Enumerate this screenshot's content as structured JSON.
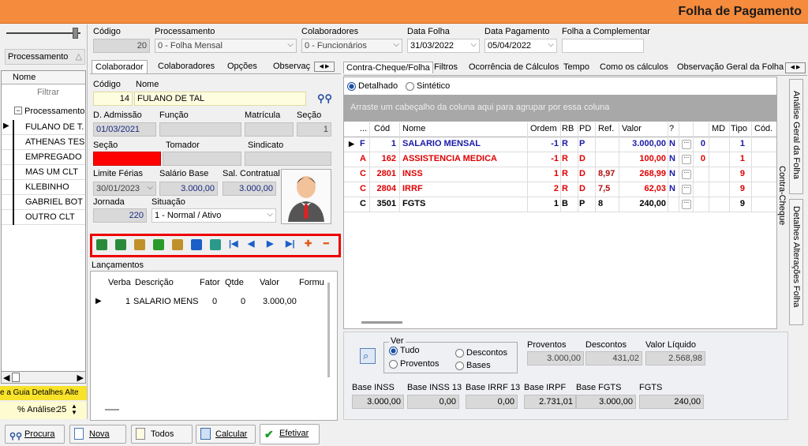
{
  "window": {
    "title": "Folha de Pagamento"
  },
  "left_panel": {
    "group_label": "Processamento",
    "header": "Nome",
    "filter_placeholder": "Filtrar",
    "tree_root": "Processamento",
    "employees": [
      "FULANO DE T.",
      "ATHENAS TES",
      "EMPREGADO",
      "MAS UM CLT",
      "KLEBINHO",
      "GABRIEL BOT",
      "OUTRO CLT"
    ],
    "banner": "e a Guia Detalhes Alte",
    "analysis_label": "% Análise:",
    "analysis_value": "25"
  },
  "header": {
    "codigo_label": "Código",
    "codigo_value": "20",
    "processamento_label": "Processamento",
    "processamento_value": "0 - Folha Mensal",
    "colaboradores_label": "Colaboradores",
    "colaboradores_value": "0 - Funcionários",
    "data_folha_label": "Data Folha",
    "data_folha_value": "31/03/2022",
    "data_pagamento_label": "Data Pagamento",
    "data_pagamento_value": "05/04/2022",
    "folha_complementar_label": "Folha a Complementar"
  },
  "left_tabs": [
    "Colaborador",
    "Colaboradores",
    "Opções",
    "Observaç"
  ],
  "employee": {
    "codigo_label": "Código",
    "nome_label": "Nome",
    "codigo": "14",
    "nome": "FULANO DE TAL",
    "admissao_label": "D. Admissão",
    "admissao": "01/03/2021",
    "funcao_label": "Função",
    "matricula_label": "Matrícula",
    "secao_label": "Seção",
    "secao_value": "1",
    "secao2_label": "Seção",
    "tomador_label": "Tomador",
    "sindicato_label": "Sindicato",
    "limite_ferias_label": "Limite Férias",
    "limite_ferias": "30/01/2023",
    "salario_base_label": "Salário Base",
    "salario_base": "3.000,00",
    "sal_contratual_label": "Sal. Contratual",
    "sal_contratual": "3.000,00",
    "jornada_label": "Jornada",
    "jornada": "220",
    "situacao_label": "Situação",
    "situacao": "1 - Normal / Ativo"
  },
  "lancamentos": {
    "title": "Lançamentos",
    "columns": [
      "Verba",
      "Descrição",
      "Fator",
      "Qtde",
      "Valor",
      "Formu"
    ],
    "rows": [
      [
        "1",
        "SALARIO MENS",
        "0",
        "0",
        "3.000,00",
        ""
      ]
    ]
  },
  "right_tabs": [
    "Contra-Cheque/Folha",
    "Filtros",
    "Ocorrência de Cálculos",
    "Tempo",
    "Como os cálculos",
    "Observação Geral da Folha"
  ],
  "view_mode": {
    "detalhado": "Detalhado",
    "sintetico": "Sintético"
  },
  "group_hint": "Arraste um cabeçalho da coluna aqui para agrupar por essa coluna",
  "grid": {
    "columns": [
      "...",
      "Cód",
      "Nome",
      "Ordem",
      "RB",
      "PD",
      "Ref.",
      "Valor",
      "?",
      "",
      "MD",
      "Tipo",
      "Cód."
    ],
    "rows": [
      {
        "flag": "F",
        "cod": "1",
        "nome": "SALARIO MENSAL",
        "ordem": "-1",
        "rb": "R",
        "pd": "P",
        "ref": "",
        "valor": "3.000,00",
        "q": "N",
        "md": "0",
        "tipo": "1",
        "color": "#1a1aa8"
      },
      {
        "flag": "A",
        "cod": "162",
        "nome": "ASSISTENCIA MEDICA",
        "ordem": "-1",
        "rb": "R",
        "pd": "D",
        "ref": "",
        "valor": "100,00",
        "q": "N",
        "md": "0",
        "tipo": "1",
        "color": "#e00000"
      },
      {
        "flag": "C",
        "cod": "2801",
        "nome": "INSS",
        "ordem": "1",
        "rb": "R",
        "pd": "D",
        "ref": "8,97",
        "valor": "268,99",
        "q": "N",
        "md": "",
        "tipo": "9",
        "color": "#e00000"
      },
      {
        "flag": "C",
        "cod": "2804",
        "nome": "IRRF",
        "ordem": "2",
        "rb": "R",
        "pd": "D",
        "ref": "7,5",
        "valor": "62,03",
        "q": "N",
        "md": "",
        "tipo": "9",
        "color": "#e00000"
      },
      {
        "flag": "C",
        "cod": "3501",
        "nome": "FGTS",
        "ordem": "1",
        "rb": "B",
        "pd": "P",
        "ref": "8",
        "valor": "240,00",
        "q": "",
        "md": "",
        "tipo": "9",
        "color": "#000000"
      }
    ]
  },
  "side_tabs": [
    "Análise Geral da Folha",
    "Detalhes Alterações Folha"
  ],
  "inner_side_tab": "Contra-Cheque",
  "summary": {
    "ver_label": "Ver",
    "options": [
      "Tudo",
      "Proventos",
      "Descontos",
      "Bases"
    ],
    "proventos_label": "Proventos",
    "proventos": "3.000,00",
    "descontos_label": "Descontos",
    "descontos": "431,02",
    "liquido_label": "Valor Líquido",
    "liquido": "2.568,98",
    "bases": [
      {
        "label": "Base INSS",
        "value": "3.000,00"
      },
      {
        "label": "Base INSS 13",
        "value": "0,00"
      },
      {
        "label": "Base IRRF 13",
        "value": "0,00"
      },
      {
        "label": "Base IRPF",
        "value": "2.731,01"
      },
      {
        "label": "Base FGTS",
        "value": "3.000,00"
      },
      {
        "label": "FGTS",
        "value": "240,00"
      }
    ]
  },
  "buttons": {
    "procura": "Procura",
    "nova": "Nova",
    "todos": "Todos",
    "calcular": "Calcular",
    "efetivar": "Efetivar"
  }
}
